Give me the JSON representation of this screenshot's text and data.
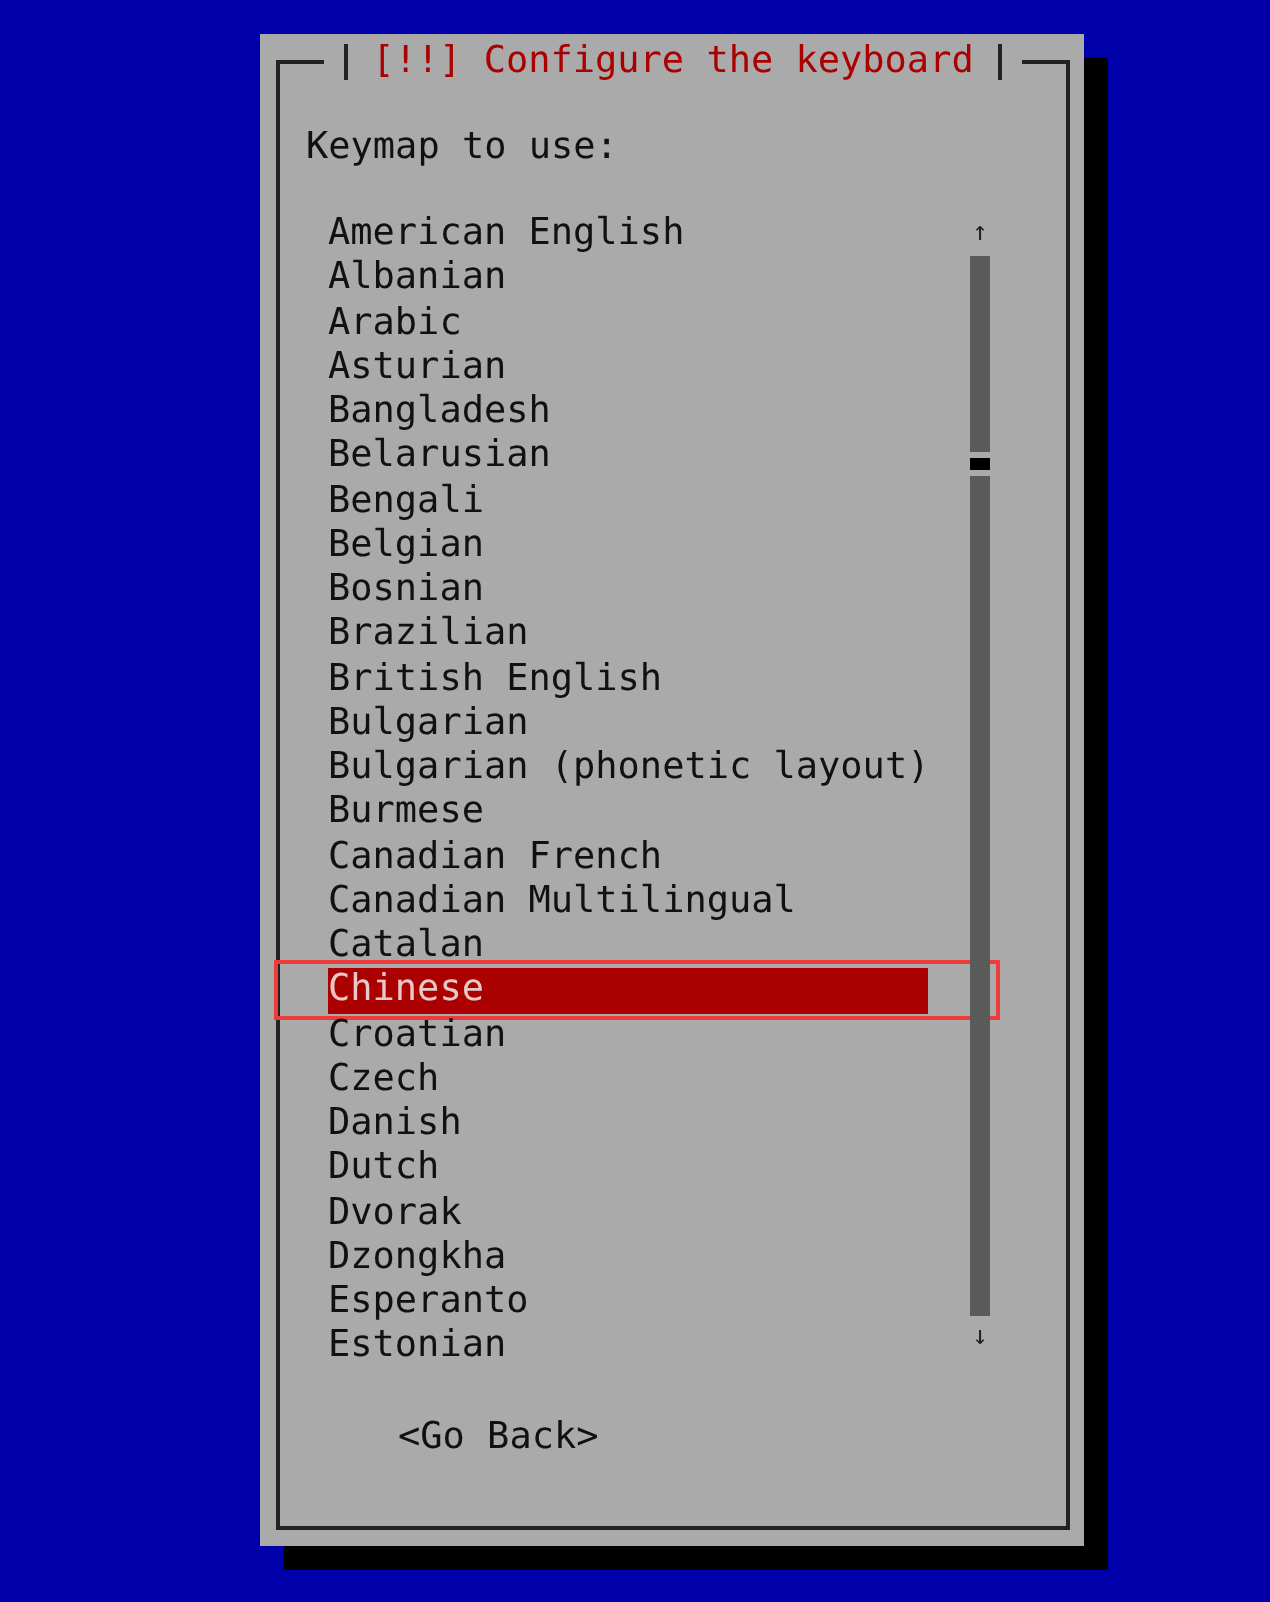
{
  "window": {
    "title": "[!!] Configure the keyboard"
  },
  "prompt": "Keymap to use:",
  "items": [
    {
      "label": "American English",
      "selected": false
    },
    {
      "label": "Albanian",
      "selected": false
    },
    {
      "label": "Arabic",
      "selected": false
    },
    {
      "label": "Asturian",
      "selected": false
    },
    {
      "label": "Bangladesh",
      "selected": false
    },
    {
      "label": "Belarusian",
      "selected": false
    },
    {
      "label": "Bengali",
      "selected": false
    },
    {
      "label": "Belgian",
      "selected": false
    },
    {
      "label": "Bosnian",
      "selected": false
    },
    {
      "label": "Brazilian",
      "selected": false
    },
    {
      "label": "British English",
      "selected": false
    },
    {
      "label": "Bulgarian",
      "selected": false
    },
    {
      "label": "Bulgarian (phonetic layout)",
      "selected": false
    },
    {
      "label": "Burmese",
      "selected": false
    },
    {
      "label": "Canadian French",
      "selected": false
    },
    {
      "label": "Canadian Multilingual",
      "selected": false
    },
    {
      "label": "Catalan",
      "selected": false
    },
    {
      "label": "Chinese",
      "selected": true
    },
    {
      "label": "Croatian",
      "selected": false
    },
    {
      "label": "Czech",
      "selected": false
    },
    {
      "label": "Danish",
      "selected": false
    },
    {
      "label": "Dutch",
      "selected": false
    },
    {
      "label": "Dvorak",
      "selected": false
    },
    {
      "label": "Dzongkha",
      "selected": false
    },
    {
      "label": "Esperanto",
      "selected": false
    },
    {
      "label": "Estonian",
      "selected": false
    }
  ],
  "scroll_arrows": {
    "up": "↑",
    "down": "↓"
  },
  "buttons": [
    {
      "label": "<Go Back>"
    }
  ]
}
